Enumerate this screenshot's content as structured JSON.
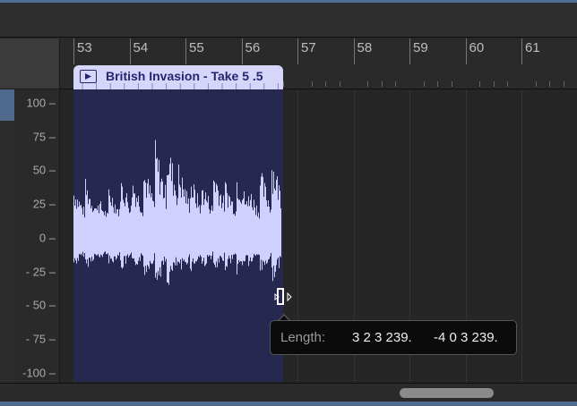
{
  "ruler": {
    "bars": [
      "53",
      "54",
      "55",
      "56",
      "57",
      "58",
      "59",
      "60",
      "61"
    ]
  },
  "region": {
    "title": "British Invasion - Take 5 .5",
    "color": "#d6d6fb",
    "body_color": "#27284f",
    "wave_color": "#d0d0ff"
  },
  "y_axis": {
    "labels": [
      "100",
      "75",
      "50",
      "25",
      "0",
      "- 25",
      "- 50",
      "- 75",
      "-100"
    ]
  },
  "tooltip": {
    "label": "Length:",
    "value1": "3 2 3 239.",
    "value2": "-4 0 3 239."
  },
  "cursor": {
    "icon": "resize-region-end-icon"
  }
}
